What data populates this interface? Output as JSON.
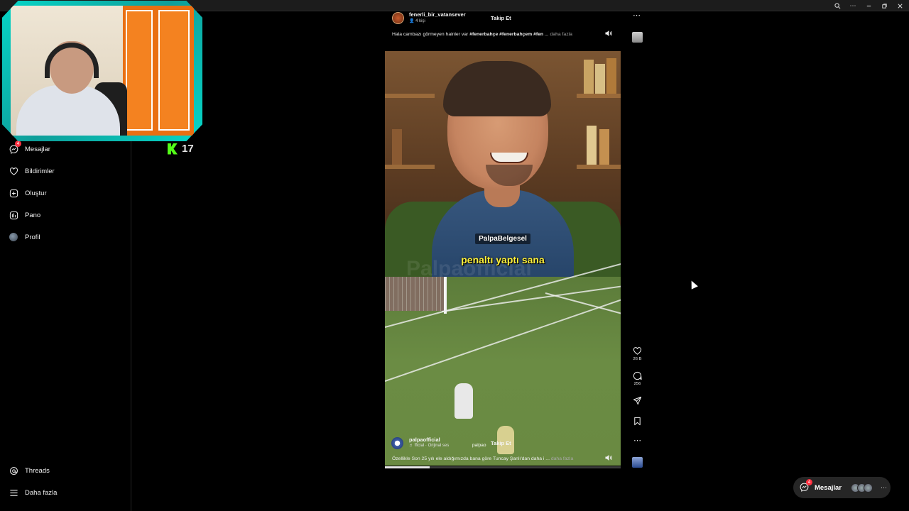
{
  "sidebar": {
    "items": [
      {
        "label": "Mesajlar",
        "icon": "messenger-icon",
        "badge": "4"
      },
      {
        "label": "Bildirimler",
        "icon": "heart-icon"
      },
      {
        "label": "Oluştur",
        "icon": "plus-square-icon"
      },
      {
        "label": "Pano",
        "icon": "dashboard-icon"
      },
      {
        "label": "Profil",
        "icon": "avatar-icon"
      }
    ],
    "bottom": [
      {
        "label": "Threads",
        "icon": "threads-icon"
      },
      {
        "label": "Daha fazla",
        "icon": "menu-icon"
      }
    ]
  },
  "stream_overlay": {
    "kick_count": "17"
  },
  "post_top": {
    "username": "fenerli_bir_vatansever",
    "people": "4 kişi",
    "follow": "Takip Et",
    "caption_start": "Hala cambazı görmeyen hainler var ",
    "caption_tags": "#fenerbahçe #fenerbahçem #fen",
    "caption_ellipsis": " ... ",
    "caption_more": "daha fazla"
  },
  "video": {
    "tag": "PalpaBelgesel",
    "subtitle": "penaltı yaptı sana",
    "watermark": "Palpaofficial",
    "progress_fraction": 0.19
  },
  "post_bottom": {
    "username": "palpaofficial",
    "audio": "fficial · Orijinal ses",
    "tag": "palpao",
    "follow": "Takip Et",
    "caption": "Özellikle Son 25 yılı ele aldığımızda bana göre Tuncay Şanlı'dan daha i",
    "caption_ellipsis": " ... ",
    "caption_more": "daha fazla"
  },
  "actions": {
    "likes": "26 B",
    "comments": "256"
  },
  "messages_pill": {
    "label": "Mesajlar",
    "badge": "4"
  },
  "colors": {
    "background": "#000000",
    "subtitle_yellow": "#fff13a",
    "badge_red": "#ff3040",
    "webcam_frame": "#06d6c7",
    "kick_green": "#53fc18"
  }
}
